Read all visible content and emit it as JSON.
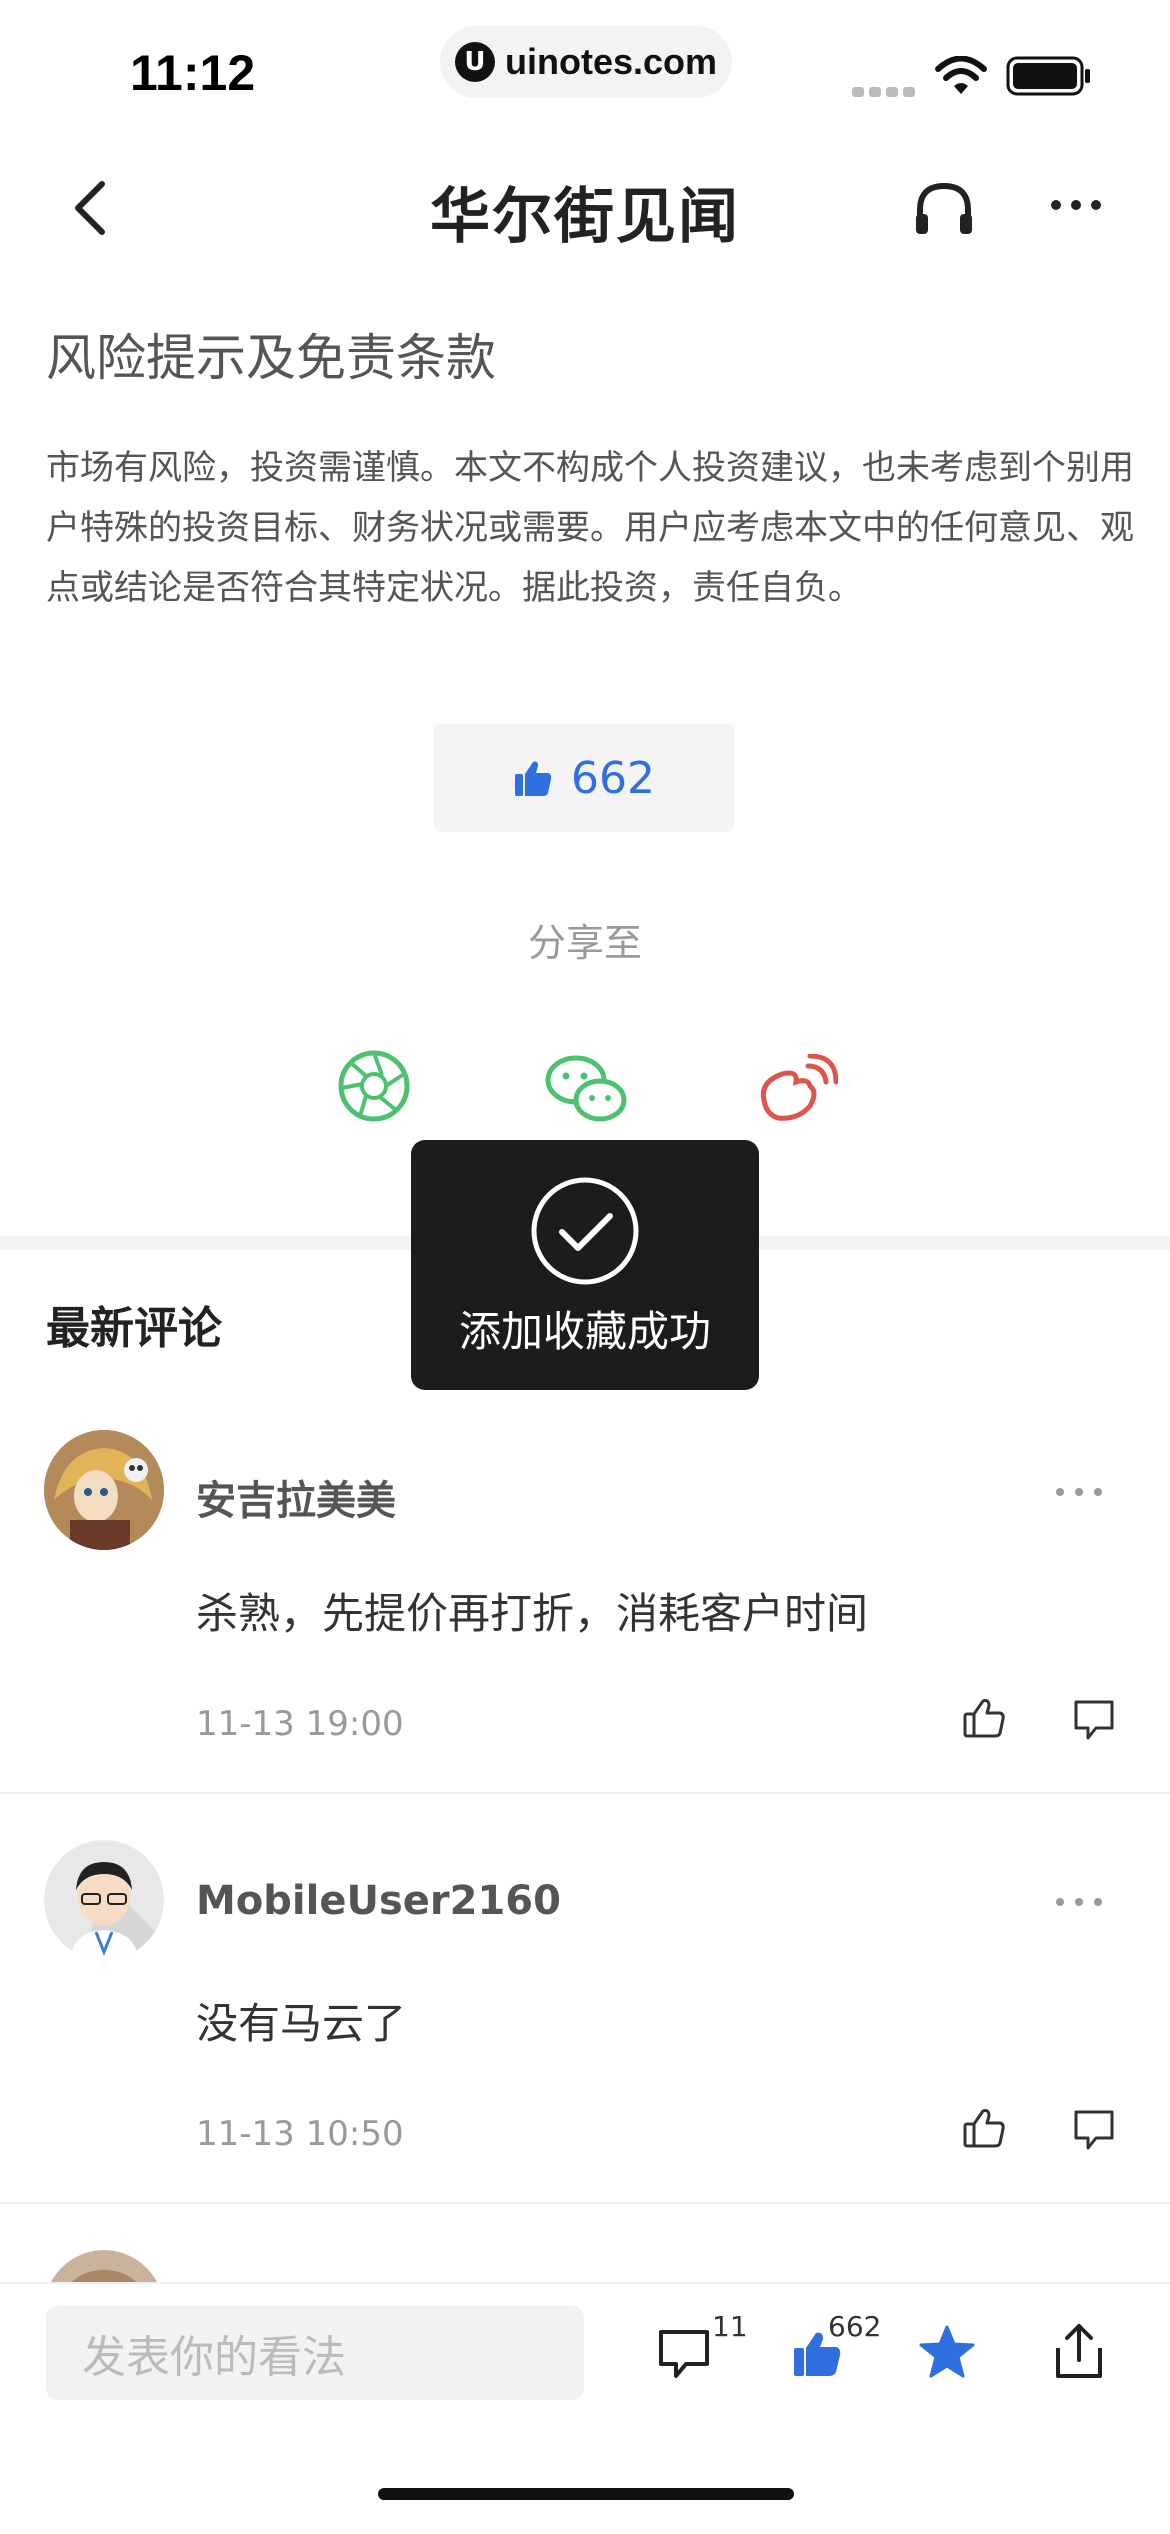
{
  "status_bar": {
    "time": "11:12",
    "url": "uinotes.com",
    "logo_letter": "U"
  },
  "nav": {
    "title": "华尔街见闻"
  },
  "disclaimer": {
    "title": "风险提示及免责条款",
    "body": "市场有风险，投资需谨慎。本文不构成个人投资建议，也未考虑到个别用户特殊的投资目标、财务状况或需要。用户应考虑本文中的任何意见、观点或结论是否符合其特定状况。据此投资，责任自负。"
  },
  "likes": {
    "count": "662"
  },
  "share": {
    "label": "分享至"
  },
  "comments": {
    "title": "最新评论",
    "items": [
      {
        "user": "安吉拉美美",
        "text": "杀熟，先提价再打折，消耗客户时间",
        "time": "11-13 19:00"
      },
      {
        "user": "MobileUser2160",
        "text": "没有马云了",
        "time": "11-13 10:50"
      }
    ]
  },
  "toast": {
    "text": "添加收藏成功"
  },
  "bottom_bar": {
    "input_placeholder": "发表你的看法",
    "comment_count": "11",
    "like_count": "662"
  },
  "colors": {
    "accent": "#2f6fe0",
    "wechat_green": "#4cc26f",
    "weibo_red": "#e0554b"
  }
}
